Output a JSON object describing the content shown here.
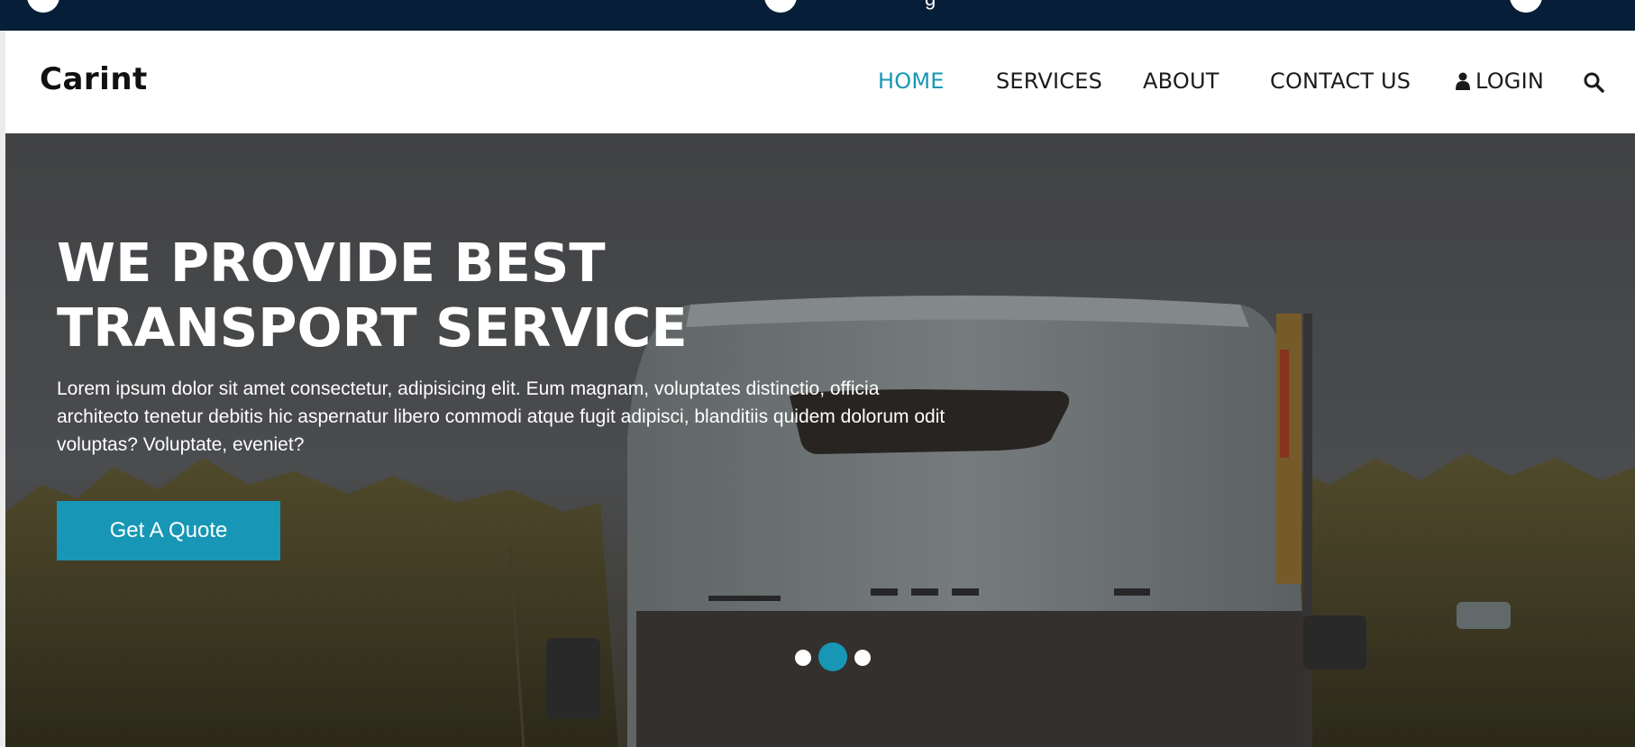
{
  "brand": {
    "name": "Carint"
  },
  "nav": {
    "items": [
      {
        "label": "HOME",
        "active": true
      },
      {
        "label": "SERVICES",
        "active": false
      },
      {
        "label": "ABOUT",
        "active": false
      },
      {
        "label": "CONTACT US",
        "active": false
      },
      {
        "label": "LOGIN",
        "active": false,
        "icon": "user-icon"
      }
    ],
    "search_icon": "search-icon"
  },
  "hero": {
    "title_line1": "WE PROVIDE BEST",
    "title_line2": "TRANSPORT SERVICE",
    "text": "Lorem ipsum dolor sit amet consectetur, adipisicing elit. Eum magnam, voluptates distinctio, officia architecto tenetur debitis hic aspernatur libero commodi atque fugit adipisci, blanditiis quidem dolorum odit voluptas? Voluptate, eveniet?",
    "cta_label": "Get A Quote",
    "slider": {
      "count": 3,
      "active_index": 1
    }
  },
  "colors": {
    "accent": "#1797b5",
    "topbar": "#061e38",
    "text_dark": "#1b1b1b",
    "white": "#ffffff"
  }
}
